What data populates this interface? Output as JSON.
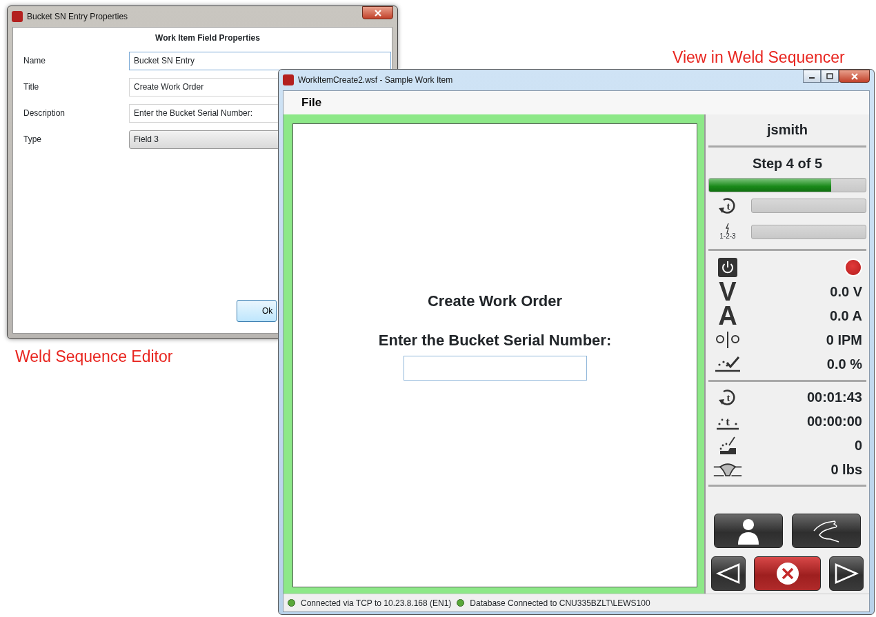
{
  "sequencer_caption": "View in Weld Sequencer",
  "editor_window": {
    "title": "Bucket SN Entry Properties",
    "heading": "Work Item Field Properties",
    "fields": [
      {
        "label": "Name",
        "value": "Bucket SN Entry",
        "kind": "text",
        "focused": true
      },
      {
        "label": "Title",
        "value": "Create Work Order",
        "kind": "text",
        "focused": false
      },
      {
        "label": "Description",
        "value": "Enter the Bucket Serial Number:",
        "kind": "text",
        "focused": false
      },
      {
        "label": "Type",
        "value": "Field 3",
        "kind": "dropdown",
        "focused": false
      }
    ],
    "ok_button": "Ok"
  },
  "editor_caption": "Weld Sequence Editor",
  "sequencer_window": {
    "title": "WorkItemCreate2.wsf - Sample Work Item",
    "menu": [
      "File"
    ],
    "prompt_title": "Create Work Order",
    "prompt_text": "Enter the Bucket Serial Number:",
    "side_panel": {
      "user": "jsmith",
      "step": "Step 4 of 5",
      "step_progress": {
        "level": 0.78
      },
      "meters": [
        {
          "kind": "timer",
          "glyph": "t",
          "level": 0
        },
        {
          "kind": "sequence",
          "glyph": "1-2-3",
          "level": 0
        }
      ],
      "lamp": {
        "on": true
      },
      "readings": [
        {
          "kind": "letter",
          "symbol": "V",
          "value": "0.0 V"
        },
        {
          "kind": "letter",
          "symbol": "A",
          "value": "0.0 A"
        },
        {
          "kind": "wire",
          "value": "0 IPM"
        },
        {
          "kind": "deposit",
          "value": "0.0 %"
        }
      ],
      "counters": [
        {
          "kind": "timer",
          "glyph": "t",
          "value": "00:01:43"
        },
        {
          "kind": "arc-time",
          "glyph": "t",
          "value": "00:00:00"
        },
        {
          "kind": "welds",
          "value": "0"
        },
        {
          "kind": "weight",
          "value": "0 lbs"
        }
      ]
    },
    "status_bar": [
      {
        "text": "Connected via TCP to 10.23.8.168 (EN1)",
        "connected": true
      },
      {
        "text": "Database Connected to CNU335BZLT\\LEWS100",
        "connected": true
      }
    ]
  }
}
